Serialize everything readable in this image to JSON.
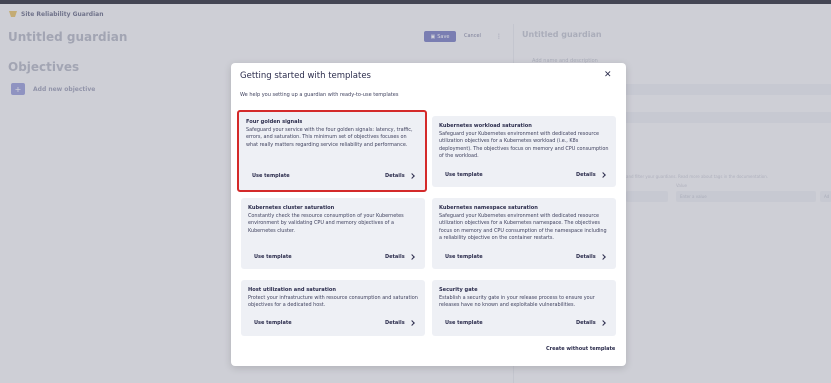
{
  "app": {
    "title": "Site Reliability Guardian"
  },
  "page": {
    "title": "Untitled guardian",
    "objectives_title": "Objectives",
    "add_objective": "Add new objective"
  },
  "toolbar": {
    "save_label": "Save",
    "cancel_label": "Cancel",
    "more_label": "⋮"
  },
  "side_panel": {
    "title": "Untitled guardian",
    "subtitle": "Add name and description",
    "hint": "and filter your guardians. Read more about tags in the documentation.",
    "value_label": "Value",
    "value_placeholder": "Enter a value",
    "add_label": "Ad"
  },
  "modal": {
    "title": "Getting started with templates",
    "close_label": "✕",
    "intro": "We help you setting up a guardian with ready-to-use templates",
    "use_template_label": "Use template",
    "details_label": "Details",
    "create_without_label": "Create without template",
    "cards": [
      {
        "title": "Four golden signals",
        "description": "Safeguard your service with the four golden signals: latency, traffic, errors, and saturation. This minimum set of objectives focuses on what really matters regarding service reliability and performance."
      },
      {
        "title": "Kubernetes workload saturation",
        "description": "Safeguard your Kubernetes environment with dedicated resource utilization objectives for a Kubernetes workload (i.e., K8s deployment). The objectives focus on memory and CPU consumption of the workload."
      },
      {
        "title": "Kubernetes cluster saturation",
        "description": "Constantly check the resource consumption of your Kubernetes environment by validating CPU and memory objectives of a Kubernetes cluster."
      },
      {
        "title": "Kubernetes namespace saturation",
        "description": "Safeguard your Kubernetes environment with dedicated resource utilization objectives for a Kubernetes namespace. The objectives focus on memory and CPU consumption of the namespace including a reliability objective on the container restarts."
      },
      {
        "title": "Host utilization and saturation",
        "description": "Protect your infrastructure with resource consumption and saturation objectives for a dedicated host."
      },
      {
        "title": "Security gate",
        "description": "Establish a security gate in your release process to ensure your releases have no known and exploitable vulnerabilities."
      }
    ]
  }
}
